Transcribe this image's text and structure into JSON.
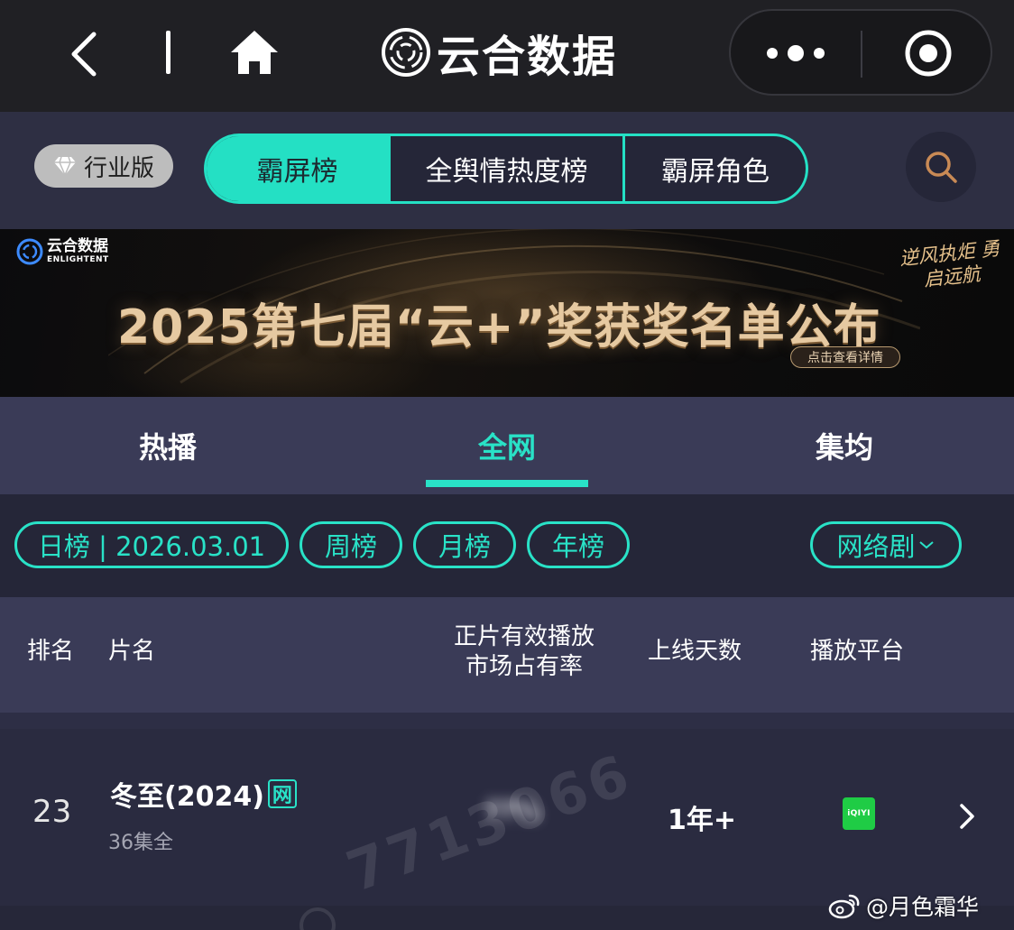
{
  "topbar": {
    "app_title": "云合数据"
  },
  "nav": {
    "edition_label": "行业版",
    "segments": [
      {
        "label": "霸屏榜",
        "active": true
      },
      {
        "label": "全舆情热度榜",
        "active": false
      },
      {
        "label": "霸屏角色",
        "active": false
      }
    ]
  },
  "banner": {
    "logo_cn": "云合数据",
    "logo_en": "ENLIGHTENT",
    "headline": "2025第七届“云+”奖获奖名单公布",
    "slogan": "逆风执炬 勇启远航",
    "cta": "点击查看详情"
  },
  "subtabs": [
    {
      "label": "热播",
      "active": false
    },
    {
      "label": "全网",
      "active": true
    },
    {
      "label": "集均",
      "active": false
    }
  ],
  "filters": {
    "daily": "日榜 | 2026.03.01",
    "weekly": "周榜",
    "monthly": "月榜",
    "yearly": "年榜",
    "category": "网络剧"
  },
  "table": {
    "headers": {
      "rank": "排名",
      "title": "片名",
      "share_line1": "正片有效播放",
      "share_line2": "市场占有率",
      "days": "上线天数",
      "platform": "播放平台"
    },
    "rows": [
      {
        "rank": "23",
        "title": "冬至(2024)",
        "badge": "网",
        "episodes": "36集全",
        "share": "??%",
        "days": "1年+",
        "platform_logo": "iQIYI"
      }
    ]
  },
  "watermarks": {
    "number": "7713066",
    "weibo_handle": "@月色霜华"
  },
  "colors": {
    "accent": "#29e2c7",
    "topbar_bg": "#202024",
    "nav_bg": "#2e2f43",
    "header_bg": "#3a3b57",
    "page_bg": "#252638",
    "iqiyi_green": "#1fcc45"
  }
}
